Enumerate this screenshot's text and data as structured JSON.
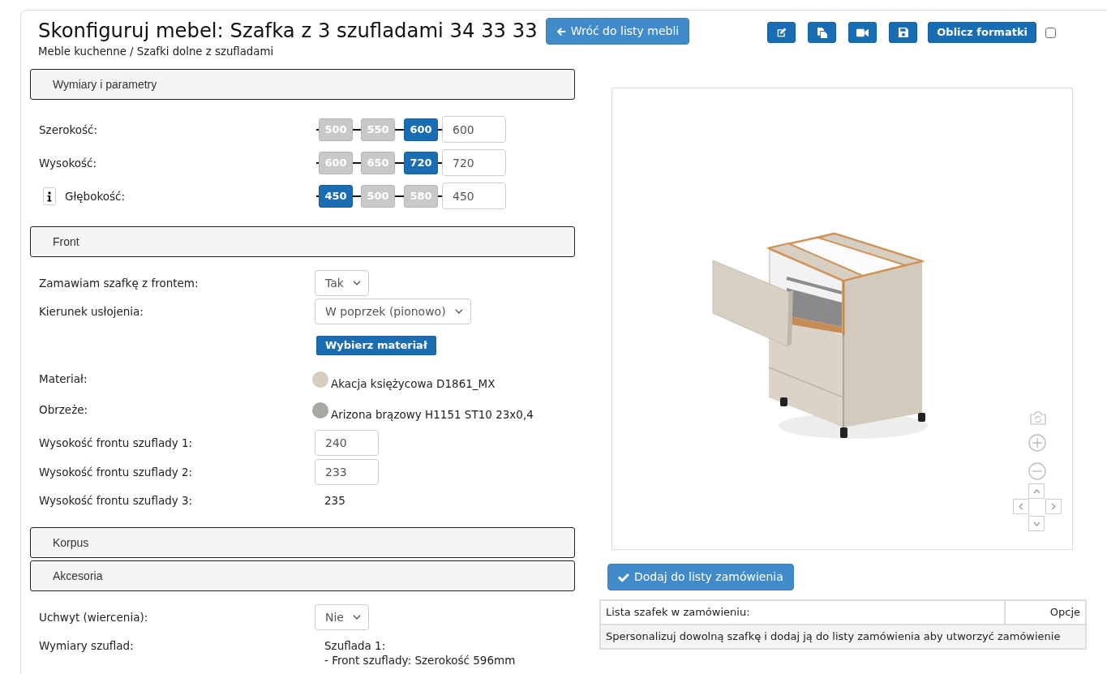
{
  "header": {
    "title": "Skonfiguruj mebel: Szafka z 3 szufladami 34 33 33",
    "back_button": "Wróć do listy mebli",
    "breadcrumb": "Meble kuchenne / Szafki dolne z szufladami",
    "calculate_button": "Oblicz formatki",
    "checkbox": {
      "checked": false
    }
  },
  "sections": [
    {
      "title": "Wymiary i parametry",
      "rows": [
        {
          "kind": "sizes",
          "label": "Szerokość:",
          "options": [
            {
              "label": "500",
              "selected": false
            },
            {
              "label": "550",
              "selected": false
            },
            {
              "label": "600",
              "selected": true
            }
          ],
          "value": "600"
        },
        {
          "kind": "sizes",
          "label": "Wysokość:",
          "options": [
            {
              "label": "600",
              "selected": false
            },
            {
              "label": "650",
              "selected": false
            },
            {
              "label": "720",
              "selected": true
            }
          ],
          "value": "720"
        },
        {
          "kind": "sizes",
          "label": "Głębokość:",
          "info": true,
          "options": [
            {
              "label": "450",
              "selected": true
            },
            {
              "label": "500",
              "selected": false
            },
            {
              "label": "580",
              "selected": false
            }
          ],
          "value": "450"
        }
      ]
    },
    {
      "title": "Front",
      "rows": [
        {
          "kind": "select",
          "label": "Zamawiam szafkę z frontem:",
          "value": "Tak"
        },
        {
          "kind": "select",
          "label": "Kierunek usłojenia:",
          "value": "W poprzek (pionowo)"
        },
        {
          "kind": "button",
          "button": "Wybierz materiał"
        },
        {
          "kind": "swatch",
          "label": "Materiał:",
          "color": "#d6ccc0",
          "value": "Akacja księżycowa D1861_MX"
        },
        {
          "kind": "swatch",
          "label": "Obrzeże:",
          "color": "#a8a8a4",
          "value": "Arizona brązowy H1151 ST10 23x0,4"
        },
        {
          "kind": "input",
          "label": "Wysokość frontu szuflady 1:",
          "value": "240"
        },
        {
          "kind": "input",
          "label": "Wysokość frontu szuflady 2:",
          "value": "233"
        },
        {
          "kind": "text",
          "label": "Wysokość frontu szuflady 3:",
          "value": "235"
        }
      ]
    },
    {
      "title": "Korpus"
    },
    {
      "title": "Akcesoria",
      "rows": [
        {
          "kind": "select",
          "label": "Uchwyt (wiercenia):",
          "value": "Nie"
        },
        {
          "kind": "lines",
          "label": "Wymiary szuflad:",
          "lines": [
            "Szuflada 1:",
            "- Front szuflady: Szerokość 596mm"
          ]
        }
      ]
    }
  ],
  "order": {
    "add_button": "Dodaj do listy zamówienia",
    "table": {
      "columns": [
        "Lista szafek w zamówieniu:",
        "Opcje"
      ],
      "empty_message": "Spersonalizuj dowolną szafkę i dodaj ją do listy zamówienia aby utworzyć zamówienie"
    }
  }
}
